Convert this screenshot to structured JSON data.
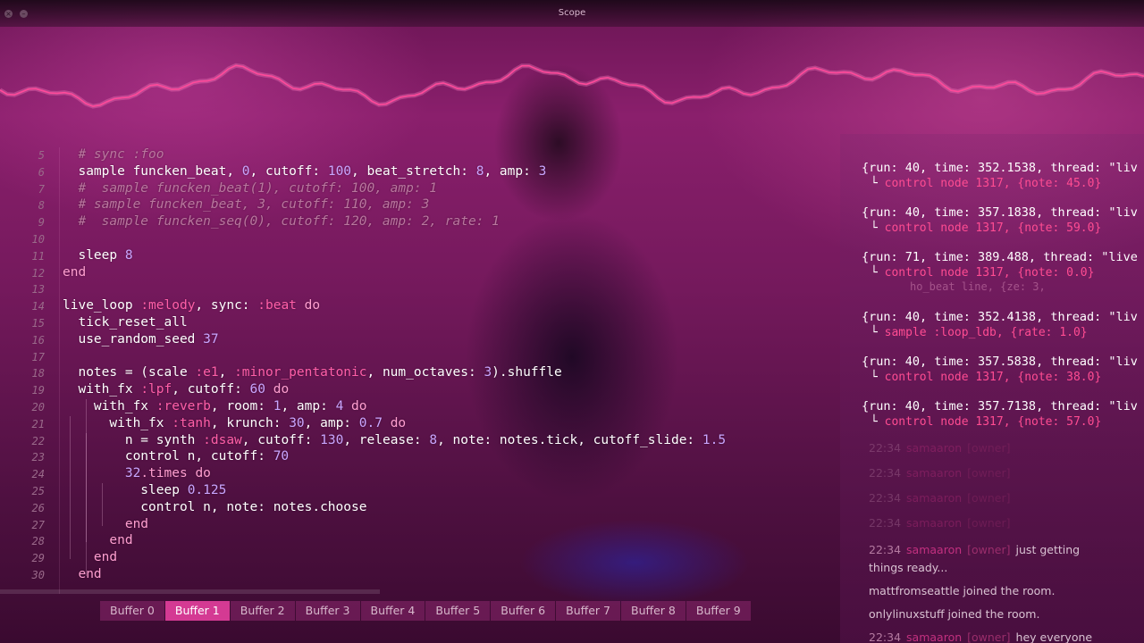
{
  "window": {
    "title": "Scope"
  },
  "colors": {
    "accent": "#d43a93",
    "scope_wave": "#ff4a9a",
    "log_text": "#ff4c92"
  },
  "icons": {
    "close": "close-icon",
    "minimize": "minimize-icon"
  },
  "editor": {
    "lines": [
      {
        "num": "5",
        "tokens": [
          [
            "c",
            "  # sync :foo"
          ]
        ]
      },
      {
        "num": "6",
        "tokens": [
          [
            "d",
            "  sample funcken_beat, "
          ],
          [
            "n",
            "0"
          ],
          [
            "d",
            ", cutoff: "
          ],
          [
            "n",
            "100"
          ],
          [
            "d",
            ", beat_stretch: "
          ],
          [
            "n",
            "8"
          ],
          [
            "d",
            ", amp: "
          ],
          [
            "n",
            "3"
          ]
        ]
      },
      {
        "num": "7",
        "tokens": [
          [
            "c",
            "  #  sample funcken_beat(1), cutoff: 100, amp: 1"
          ]
        ]
      },
      {
        "num": "8",
        "tokens": [
          [
            "c",
            "  # sample funcken_beat, 3, cutoff: 110, amp: 3"
          ]
        ]
      },
      {
        "num": "9",
        "tokens": [
          [
            "c",
            "  #  sample funcken_seq(0), cutoff: 120, amp: 2, rate: 1"
          ]
        ]
      },
      {
        "num": "10",
        "tokens": []
      },
      {
        "num": "11",
        "tokens": [
          [
            "d",
            "  sleep "
          ],
          [
            "n",
            "8"
          ]
        ]
      },
      {
        "num": "12",
        "tokens": [
          [
            "k",
            "end"
          ]
        ]
      },
      {
        "num": "13",
        "tokens": []
      },
      {
        "num": "14",
        "tokens": [
          [
            "d",
            "live_loop "
          ],
          [
            "s",
            ":melody"
          ],
          [
            "d",
            ", sync: "
          ],
          [
            "s",
            ":beat"
          ],
          [
            "d",
            " "
          ],
          [
            "k",
            "do"
          ]
        ]
      },
      {
        "num": "15",
        "tokens": [
          [
            "d",
            "  tick_reset_all"
          ]
        ]
      },
      {
        "num": "16",
        "tokens": [
          [
            "d",
            "  use_random_seed "
          ],
          [
            "n",
            "37"
          ]
        ]
      },
      {
        "num": "17",
        "tokens": []
      },
      {
        "num": "18",
        "tokens": [
          [
            "d",
            "  notes = (scale "
          ],
          [
            "s",
            ":e1"
          ],
          [
            "d",
            ", "
          ],
          [
            "s",
            ":minor_pentatonic"
          ],
          [
            "d",
            ", num_octaves: "
          ],
          [
            "n",
            "3"
          ],
          [
            "d",
            ").shuffle"
          ]
        ]
      },
      {
        "num": "19",
        "tokens": [
          [
            "d",
            "  with_fx "
          ],
          [
            "s",
            ":lpf"
          ],
          [
            "d",
            ", cutoff: "
          ],
          [
            "n",
            "60"
          ],
          [
            "d",
            " "
          ],
          [
            "k",
            "do"
          ]
        ]
      },
      {
        "num": "20",
        "tokens": [
          [
            "d",
            "    with_fx "
          ],
          [
            "s",
            ":reverb"
          ],
          [
            "d",
            ", room: "
          ],
          [
            "n",
            "1"
          ],
          [
            "d",
            ", amp: "
          ],
          [
            "n",
            "4"
          ],
          [
            "d",
            " "
          ],
          [
            "k",
            "do"
          ]
        ]
      },
      {
        "num": "21",
        "tokens": [
          [
            "d",
            "      with_fx "
          ],
          [
            "s",
            ":tanh"
          ],
          [
            "d",
            ", krunch: "
          ],
          [
            "n",
            "30"
          ],
          [
            "d",
            ", amp: "
          ],
          [
            "n",
            "0.7"
          ],
          [
            "d",
            " "
          ],
          [
            "k",
            "do"
          ]
        ]
      },
      {
        "num": "22",
        "tokens": [
          [
            "d",
            "        n = synth "
          ],
          [
            "s",
            ":dsaw"
          ],
          [
            "d",
            ", cutoff: "
          ],
          [
            "n",
            "130"
          ],
          [
            "d",
            ", release: "
          ],
          [
            "n",
            "8"
          ],
          [
            "d",
            ", note: notes.tick, cutoff_slide: "
          ],
          [
            "n",
            "1.5"
          ]
        ]
      },
      {
        "num": "23",
        "tokens": [
          [
            "d",
            "        control n, cutoff: "
          ],
          [
            "n",
            "70"
          ]
        ]
      },
      {
        "num": "24",
        "tokens": [
          [
            "d",
            "        "
          ],
          [
            "n",
            "32"
          ],
          [
            "k",
            ".times"
          ],
          [
            "d",
            " "
          ],
          [
            "k",
            "do"
          ]
        ]
      },
      {
        "num": "25",
        "tokens": [
          [
            "d",
            "          sleep "
          ],
          [
            "n",
            "0.125"
          ]
        ]
      },
      {
        "num": "26",
        "tokens": [
          [
            "d",
            "          control n, note: notes.choose"
          ]
        ]
      },
      {
        "num": "27",
        "tokens": [
          [
            "d",
            "        "
          ],
          [
            "k",
            "end"
          ]
        ]
      },
      {
        "num": "28",
        "tokens": [
          [
            "d",
            "      "
          ],
          [
            "k",
            "end"
          ]
        ]
      },
      {
        "num": "29",
        "tokens": [
          [
            "d",
            "    "
          ],
          [
            "k",
            "end"
          ]
        ]
      },
      {
        "num": "30",
        "tokens": [
          [
            "d",
            "  "
          ],
          [
            "k",
            "end"
          ]
        ]
      }
    ]
  },
  "buffers": {
    "tabs": [
      "Buffer 0",
      "Buffer 1",
      "Buffer 2",
      "Buffer 3",
      "Buffer 4",
      "Buffer 5",
      "Buffer 6",
      "Buffer 7",
      "Buffer 8",
      "Buffer 9"
    ],
    "active": "Buffer 1"
  },
  "log": [
    {
      "head": "{run: 40, time: 352.1538, thread: \"liv",
      "body_tree": "└ ",
      "body": "control node 1317, {note: 45.0}"
    },
    {
      "head": "{run: 40, time: 357.1838, thread: \"liv",
      "body_tree": "└ ",
      "body": "control node 1317, {note: 59.0}"
    },
    {
      "head": "{run: 71, time: 389.488, thread: \"live",
      "body_tree": "└ ",
      "body": "control node 1317, {note: 0.0}",
      "extra": "ho_beat line, {ze: 3,"
    },
    {
      "head": "{run: 40, time: 352.4138, thread: \"liv",
      "body_tree": "└ ",
      "body": "sample :loop_ldb, {rate: 1.0}"
    },
    {
      "head": "{run: 40, time: 357.5838, thread: \"liv",
      "body_tree": "└ ",
      "body": "control node 1317, {note: 38.0}"
    },
    {
      "head": "{run: 40, time: 357.7138, thread: \"liv",
      "body_tree": "└ ",
      "body": "control node 1317, {note: 57.0}"
    }
  ],
  "chat": [
    {
      "time": "22:34",
      "user": "samaaron",
      "role": "[owner]",
      "text": ""
    },
    {
      "time": "22:34",
      "user": "samaaron",
      "role": "[owner]",
      "text": ""
    },
    {
      "time": "22:34",
      "user": "samaaron",
      "role": "[owner]",
      "text": ""
    },
    {
      "time": "22:34",
      "user": "samaaron",
      "role": "[owner]",
      "text": ""
    },
    {
      "time": "22:34",
      "user": "samaaron",
      "role": "[owner]",
      "text": "just getting"
    },
    {
      "time": "",
      "user": "",
      "role": "",
      "text": "things ready..."
    },
    {
      "time": "",
      "user": "",
      "role": "",
      "text": "mattfromseattle joined the room."
    },
    {
      "time": "",
      "user": "",
      "role": "",
      "text": "onlylinuxstuff joined the room."
    },
    {
      "time": "22:34",
      "user": "samaaron",
      "role": "[owner]",
      "text": "hey everyone"
    }
  ]
}
